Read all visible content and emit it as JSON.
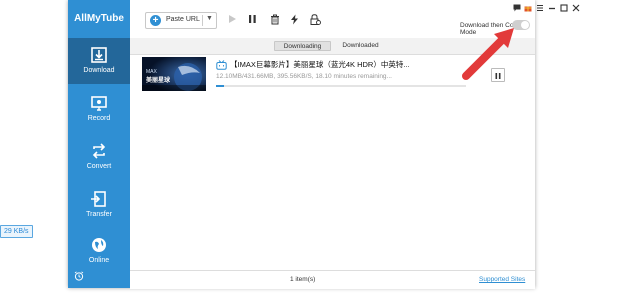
{
  "speed_badge": "29 KB/s",
  "app": {
    "logo": "AllMyTube",
    "sidebar": [
      {
        "label": "Download",
        "icon": "download-icon"
      },
      {
        "label": "Record",
        "icon": "record-icon"
      },
      {
        "label": "Convert",
        "icon": "convert-icon"
      },
      {
        "label": "Transfer",
        "icon": "transfer-icon"
      },
      {
        "label": "Online",
        "icon": "globe-icon"
      }
    ],
    "toolbar": {
      "paste_url": "Paste URL",
      "mode_label": "Download then Convert Mode"
    },
    "tabs": [
      "Downloading",
      "Downloaded"
    ],
    "item": {
      "thumb_label": "美丽星球",
      "thumb_sub": "MAX",
      "title": "【IMAX巨幕影片】美丽星球（蓝光4K HDR）中英特...",
      "progress_text": "12.10MB/431.66MB, 395.56KB/S, 18.10 minutes remaining...",
      "progress": 0.03
    },
    "status": {
      "count": "1 item(s)",
      "supported_sites": "Supported Sites"
    },
    "colors": {
      "accent": "#2f8fd3",
      "sidebar_active": "#23679a",
      "arrow": "#e23a3a"
    }
  }
}
